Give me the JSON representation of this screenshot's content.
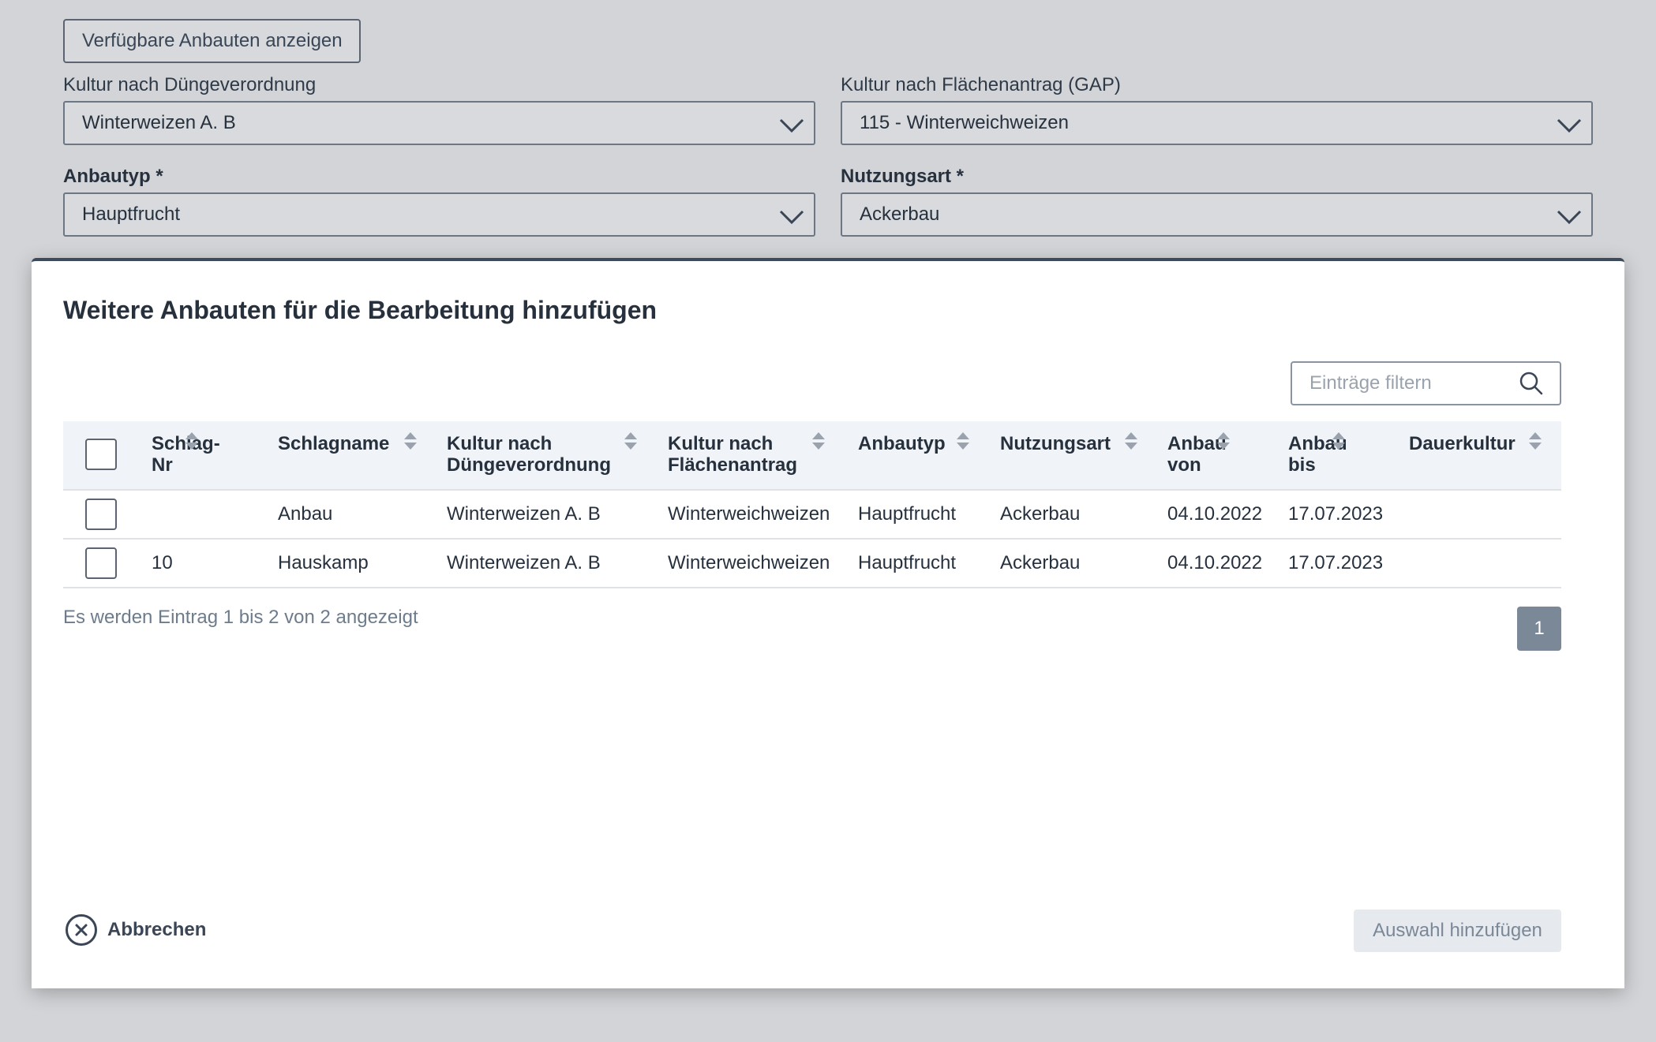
{
  "form": {
    "show_button": "Verfügbare Anbauten anzeigen",
    "crop_dv_label": "Kultur nach Düngeverordnung",
    "crop_dv_value": "Winterweizen A. B",
    "crop_gap_label": "Kultur nach Flächenantrag (GAP)",
    "crop_gap_value": "115 - Winterweichweizen",
    "anbautyp_label": "Anbautyp *",
    "anbautyp_value": "Hauptfrucht",
    "nutzungsart_label": "Nutzungsart *",
    "nutzungsart_value": "Ackerbau"
  },
  "modal": {
    "title": "Weitere Anbauten für die Bearbeitung hinzufügen",
    "filter_placeholder": "Einträge filtern",
    "columns": {
      "schlag_nr_1": "Schlag-",
      "schlag_nr_2": "Nr",
      "schlagname": "Schlagname",
      "kultur_dv_1": "Kultur nach",
      "kultur_dv_2": "Düngeverordnung",
      "kultur_fa_1": "Kultur nach",
      "kultur_fa_2": "Flächenantrag",
      "anbautyp": "Anbautyp",
      "nutzungsart": "Nutzungsart",
      "anbau_von_1": "Anbau",
      "anbau_von_2": "von",
      "anbau_bis_1": "Anbau",
      "anbau_bis_2": "bis",
      "dauerkultur": "Dauerkultur"
    },
    "rows": [
      {
        "schlag_nr": "",
        "schlagname": "Anbau",
        "kultur_dv": "Winterweizen A. B",
        "kultur_fa": "Winterweichweizen",
        "anbautyp": "Hauptfrucht",
        "nutzungsart": "Ackerbau",
        "von": "04.10.2022",
        "bis": "17.07.2023",
        "dauerkultur": ""
      },
      {
        "schlag_nr": "10",
        "schlagname": "Hauskamp",
        "kultur_dv": "Winterweizen A. B",
        "kultur_fa": "Winterweichweizen",
        "anbautyp": "Hauptfrucht",
        "nutzungsart": "Ackerbau",
        "von": "04.10.2022",
        "bis": "17.07.2023",
        "dauerkultur": ""
      }
    ],
    "info": "Es werden Eintrag 1 bis 2 von 2 angezeigt",
    "page": "1",
    "cancel_label": "Abbrechen",
    "add_label": "Auswahl hinzufügen"
  }
}
